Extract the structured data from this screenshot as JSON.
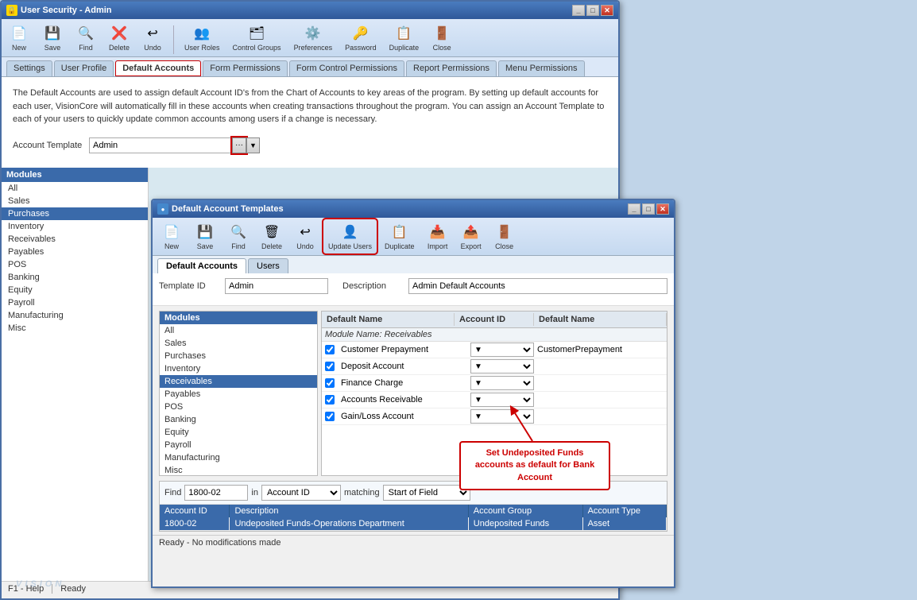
{
  "mainWindow": {
    "title": "User Security - Admin",
    "tabs": [
      "Settings",
      "User Profile",
      "Default Accounts",
      "Form Permissions",
      "Form Control Permissions",
      "Report Permissions",
      "Menu Permissions"
    ],
    "activeTab": "Default Accounts",
    "toolbar": {
      "buttons": [
        "New",
        "Save",
        "Find",
        "Delete",
        "Undo",
        "User Roles",
        "Control Groups",
        "Preferences",
        "Password",
        "Duplicate",
        "Close"
      ]
    },
    "description": "The Default Accounts are used to assign default Account ID's from the Chart of Accounts to key areas of the program. By setting up default accounts for each user, VisionCore will automatically fill in these accounts when creating transactions throughout the program. You can assign an Account Template to each of your users to quickly update common accounts among users if a change is necessary.",
    "accountTemplate": {
      "label": "Account Template",
      "value": "Admin"
    },
    "modules": {
      "header": "Modules",
      "items": [
        "All",
        "Sales",
        "Purchases",
        "Inventory",
        "Receivables",
        "Payables",
        "POS",
        "Banking",
        "Equity",
        "Payroll",
        "Manufacturing",
        "Misc"
      ],
      "selected": "Purchases"
    },
    "statusBar": {
      "help": "F1 - Help",
      "status": "Ready"
    }
  },
  "subWindow": {
    "title": "Default Account Templates",
    "toolbar": {
      "buttons": [
        "New",
        "Save",
        "Find",
        "Delete",
        "Undo",
        "Update Users",
        "Duplicate",
        "Import",
        "Export",
        "Close"
      ]
    },
    "tabs": [
      "Default Accounts",
      "Users"
    ],
    "activeTab": "Default Accounts",
    "templateId": {
      "label": "Template ID",
      "value": "Admin"
    },
    "description": {
      "label": "Description",
      "value": "Admin Default Accounts"
    },
    "tableColumns": {
      "modules": "Modules",
      "defaultName": "Default Name",
      "accountId": "Account ID",
      "defaultName2": "Default Name"
    },
    "leftModules": {
      "header": "Modules",
      "items": [
        "All",
        "Sales",
        "Purchases",
        "Inventory",
        "Receivables",
        "Payables",
        "POS",
        "Banking",
        "Equity",
        "Payroll",
        "Manufacturing",
        "Misc"
      ],
      "selected": "Receivables"
    },
    "moduleHeader": "Module Name: Receivables",
    "dataRows": [
      {
        "checked": true,
        "name": "Customer Prepayment",
        "account": "CustomerPrepayment"
      },
      {
        "checked": true,
        "name": "Deposit Account",
        "account": ""
      },
      {
        "checked": true,
        "name": "Finance Charge",
        "account": ""
      },
      {
        "checked": true,
        "name": "Accounts Receivable",
        "account": ""
      },
      {
        "checked": true,
        "name": "Gain/Loss Account",
        "account": ""
      }
    ],
    "find": {
      "label": "Find",
      "value": "1800-02",
      "inLabel": "in",
      "inField": "Account ID",
      "matchingLabel": "matching",
      "matchingField": "Start of Field",
      "resultColumns": [
        "Account ID",
        "Description",
        "Account Group",
        "Account Type"
      ],
      "results": [
        {
          "id": "1800-02",
          "description": "Undeposited Funds-Operations Department",
          "group": "Undeposited Funds",
          "type": "Asset"
        }
      ]
    },
    "statusBar": "Ready - No modifications made"
  },
  "annotation": {
    "text": "Set Undeposited Funds\naccounts as default for Bank\nAccount"
  },
  "logo": "VISION"
}
